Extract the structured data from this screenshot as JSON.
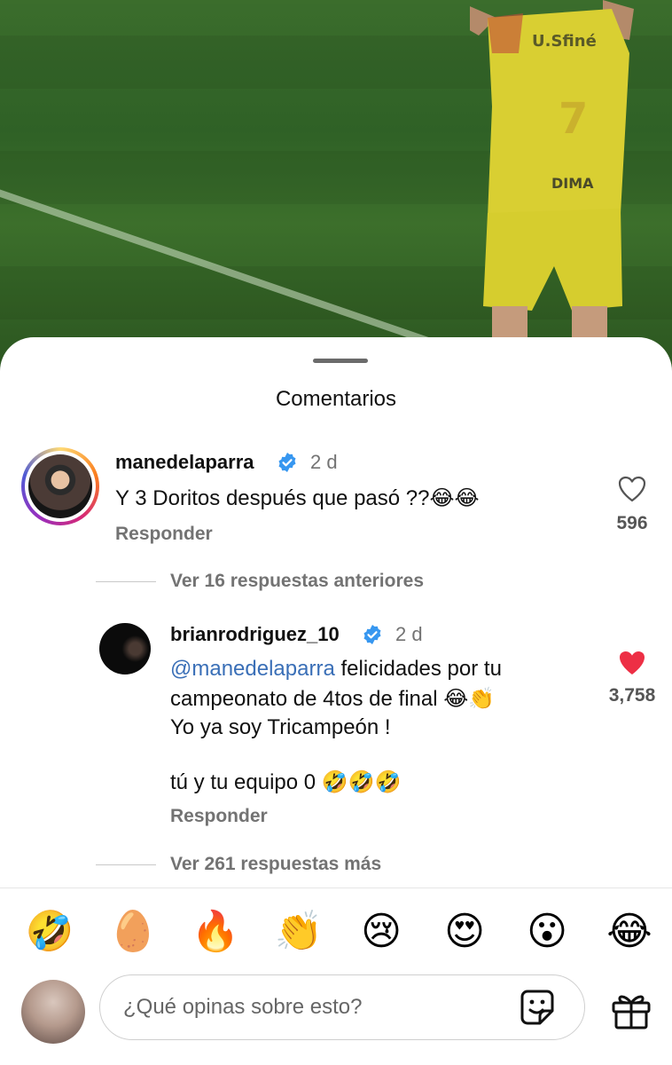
{
  "sheet": {
    "title": "Comentarios"
  },
  "comments": [
    {
      "username": "manedelaparra",
      "time": "2 d",
      "text": "Y 3 Doritos después que pasó ??😂😂",
      "reply_label": "Responder",
      "likes": "596",
      "liked": false
    },
    {
      "username": "brianrodriguez_10",
      "time": "2 d",
      "mention": "@manedelaparra",
      "text_line1_rest": " felicidades por tu",
      "text_line2": "campeonato de 4tos de final 😂👏",
      "text_line3": "Yo ya soy Tricampeón !",
      "text_line4": "tú y tu equipo 0 🤣🤣🤣",
      "reply_label": "Responder",
      "likes": "3,758",
      "liked": true
    }
  ],
  "replies": {
    "previous_label": "Ver 16 respuestas anteriores",
    "more_label": "Ver 261 respuestas más"
  },
  "reactions": [
    "🤣",
    "🥚",
    "🔥",
    "👏",
    "😢",
    "😍",
    "😮",
    "😂"
  ],
  "composer": {
    "placeholder": "¿Qué opinas sobre esto?"
  },
  "colors": {
    "like_red": "#ed2f45",
    "mention_blue": "#3a6fb7",
    "verified_blue": "#3797f0"
  }
}
